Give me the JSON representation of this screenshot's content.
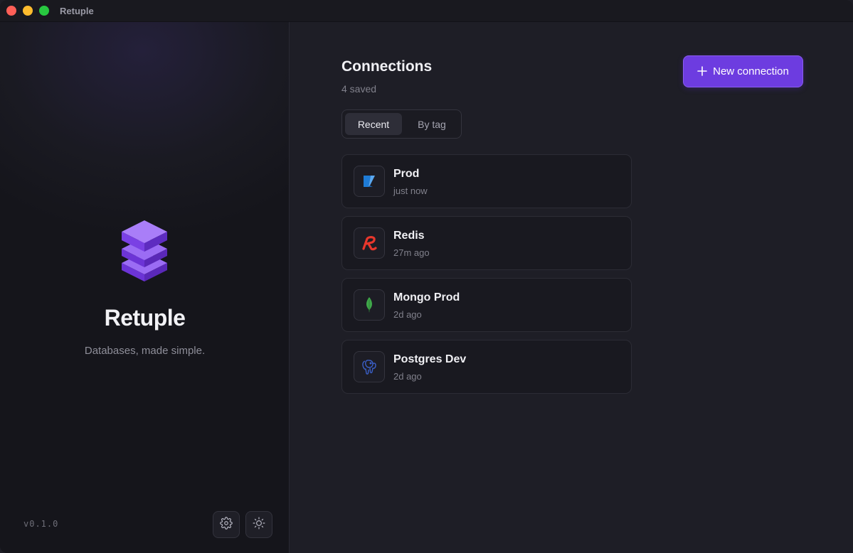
{
  "window": {
    "title": "Retuple"
  },
  "sidebar": {
    "brand": "Retuple",
    "tagline": "Databases, made simple.",
    "version": "v0.1.0"
  },
  "main": {
    "title": "Connections",
    "subtitle": "4 saved",
    "new_button_label": "New connection",
    "tabs": [
      {
        "label": "Recent",
        "active": true
      },
      {
        "label": "By tag",
        "active": false
      }
    ],
    "connections": [
      {
        "name": "Prod",
        "time": "just now",
        "icon": "azure-sql-icon"
      },
      {
        "name": "Redis",
        "time": "27m ago",
        "icon": "redis-icon"
      },
      {
        "name": "Mongo Prod",
        "time": "2d ago",
        "icon": "mongodb-leaf-icon"
      },
      {
        "name": "Postgres Dev",
        "time": "2d ago",
        "icon": "postgres-elephant-icon"
      }
    ]
  },
  "colors": {
    "accent": "#6d3ce0",
    "redis": "#e8372c",
    "mongo": "#3fa84a",
    "azure": "#1e7bd6",
    "postgres": "#3a5fc8"
  }
}
